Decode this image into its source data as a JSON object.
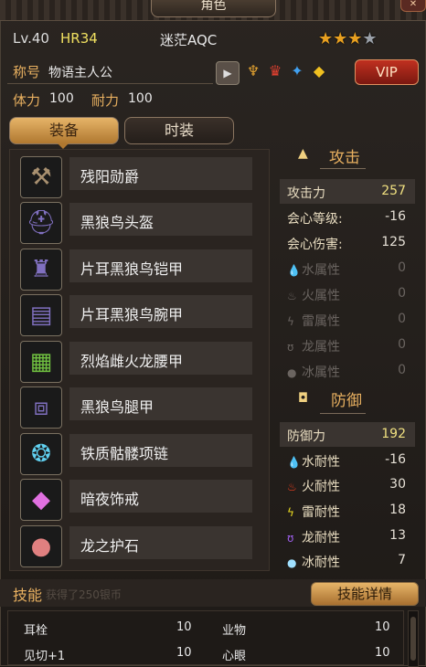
{
  "window": {
    "title": "角色",
    "close_label": "✕"
  },
  "header": {
    "level": "Lv.40",
    "hr": "HR34",
    "player_name": "迷茫AQC",
    "stars": {
      "filled": 3,
      "total": 4
    }
  },
  "profile": {
    "title_label": "称号",
    "title_value": "物语主人公",
    "vip_label": "VIP",
    "stamina_label": "体力",
    "stamina_value": "100",
    "endurance_label": "耐力",
    "endurance_value": "100"
  },
  "tabs": {
    "equipment": "装备",
    "fashion": "时装"
  },
  "equipment": [
    {
      "name": "残阳勋爵",
      "icon": "axe-icon"
    },
    {
      "name": "黑狼鸟头盔",
      "icon": "helmet-icon"
    },
    {
      "name": "片耳黑狼鸟铠甲",
      "icon": "armor-icon"
    },
    {
      "name": "片耳黑狼鸟腕甲",
      "icon": "gauntlet-icon"
    },
    {
      "name": "烈焰雌火龙腰甲",
      "icon": "waist-icon"
    },
    {
      "name": "黑狼鸟腿甲",
      "icon": "leg-icon"
    },
    {
      "name": "铁质骷髅项链",
      "icon": "necklace-icon"
    },
    {
      "name": "暗夜饰戒",
      "icon": "ring-icon"
    },
    {
      "name": "龙之护石",
      "icon": "talisman-icon"
    }
  ],
  "attack": {
    "header": "攻击",
    "stats": [
      {
        "label": "攻击力",
        "value": "257"
      },
      {
        "label": "会心等级:",
        "value": "-16"
      },
      {
        "label": "会心伤害:",
        "value": "125"
      },
      {
        "label": "水属性",
        "value": "0"
      },
      {
        "label": "火属性",
        "value": "0"
      },
      {
        "label": "雷属性",
        "value": "0"
      },
      {
        "label": "龙属性",
        "value": "0"
      },
      {
        "label": "冰属性",
        "value": "0"
      }
    ]
  },
  "defense": {
    "header": "防御",
    "stats": [
      {
        "label": "防御力",
        "value": "192"
      },
      {
        "label": "水耐性",
        "value": "-16"
      },
      {
        "label": "火耐性",
        "value": "30"
      },
      {
        "label": "雷耐性",
        "value": "18"
      },
      {
        "label": "龙耐性",
        "value": "13"
      },
      {
        "label": "冰耐性",
        "value": "7"
      }
    ]
  },
  "skills": {
    "title": "技能",
    "hint": "获得了250银币",
    "detail_button": "技能详情",
    "rows": [
      {
        "name": "耳栓",
        "value": "10",
        "name2": "业物",
        "value2": "10"
      },
      {
        "name": "见切+1",
        "value": "10",
        "name2": "心眼",
        "value2": "10"
      }
    ]
  },
  "colors": {
    "accent_gold": "#e8b060",
    "vip_red": "#c03020",
    "value_yellow": "#f0e080"
  }
}
